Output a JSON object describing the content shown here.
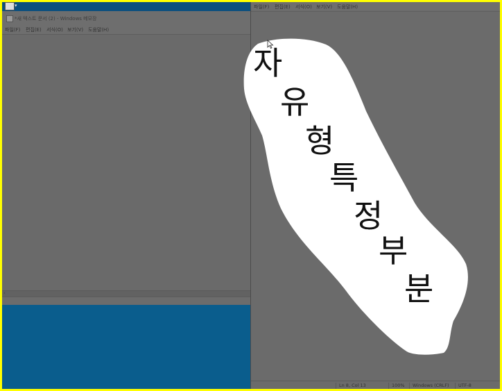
{
  "left_window": {
    "title": "*새 텍스트 문서 (2) - Windows 메모장",
    "menu": [
      "파일(F)",
      "편집(E)",
      "서식(O)",
      "보기(V)",
      "도움말(H)"
    ]
  },
  "right_window": {
    "menu": [
      "파일(F)",
      "편집(E)",
      "서식(O)",
      "보기(V)",
      "도움말(H)"
    ],
    "status": {
      "position": "Ln 8, Col 13",
      "zoom": "100%",
      "line_ending": "Windows (CRLF)",
      "encoding": "UTF-8"
    }
  },
  "drawn_text": {
    "chars": [
      "자",
      "유",
      "형",
      "특",
      "정",
      "부",
      "분"
    ]
  },
  "colors": {
    "highlight_border": "#ffff00",
    "desktop": "#0a5d8d",
    "dim_window": "#6b6b6b",
    "selection": "#ffffff"
  }
}
